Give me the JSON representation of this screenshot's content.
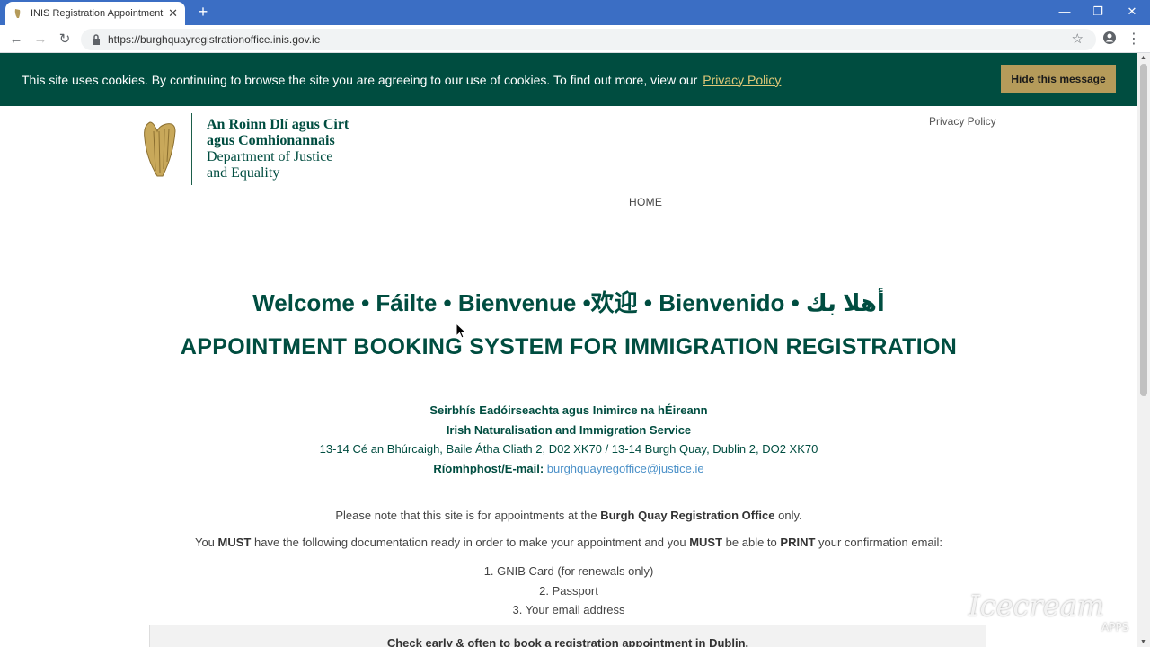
{
  "browser": {
    "tab_title": "INIS Registration Appointment Bo",
    "url": "https://burghquayregistrationoffice.inis.gov.ie"
  },
  "cookie_banner": {
    "message": "This site uses cookies. By continuing to browse the site you are agreeing to our use of cookies. To find out more, view our",
    "privacy_link": "Privacy Policy",
    "hide_button": "Hide this message"
  },
  "header": {
    "logo_line1": "An Roinn Dlí agus Cirt",
    "logo_line2": "agus Comhionannais",
    "logo_line3": "Department of Justice",
    "logo_line4": "and Equality",
    "privacy_link": "Privacy Policy",
    "nav_home": "HOME"
  },
  "main": {
    "welcome": "Welcome • Fáilte • Bienvenue •欢迎 • Bienvenido • أهلا بك",
    "headline": "APPOINTMENT BOOKING SYSTEM FOR IMMIGRATION REGISTRATION",
    "service_irish": "Seirbhís Eadóirseachta agus Inimirce na hÉireann",
    "service_english": "Irish Naturalisation and Immigration Service",
    "address": "13-14 Cé an Bhúrcaigh, Baile Átha Cliath 2, D02 XK70 / 13-14 Burgh Quay, Dublin 2, DO2 XK70",
    "email_label": "Ríomhphost/E-mail:",
    "email": "burghquayregoffice@justice.ie",
    "note1_pre": "Please note that this site is for appointments at the",
    "note1_bold": "Burgh Quay Registration Office",
    "note1_post": "only.",
    "note2_a": "You",
    "note2_must1": "MUST",
    "note2_b": "have the following documentation ready in order to make your appointment and you",
    "note2_must2": "MUST",
    "note2_c": "be able to",
    "note2_print": "PRINT",
    "note2_d": "your confirmation email:",
    "list": [
      "1. GNIB Card (for renewals only)",
      "2. Passport",
      "3. Your email address"
    ],
    "notice": "Check early & often to book a registration appointment in Dublin."
  },
  "watermark": {
    "text": "Icecream",
    "sub": "APPS"
  }
}
